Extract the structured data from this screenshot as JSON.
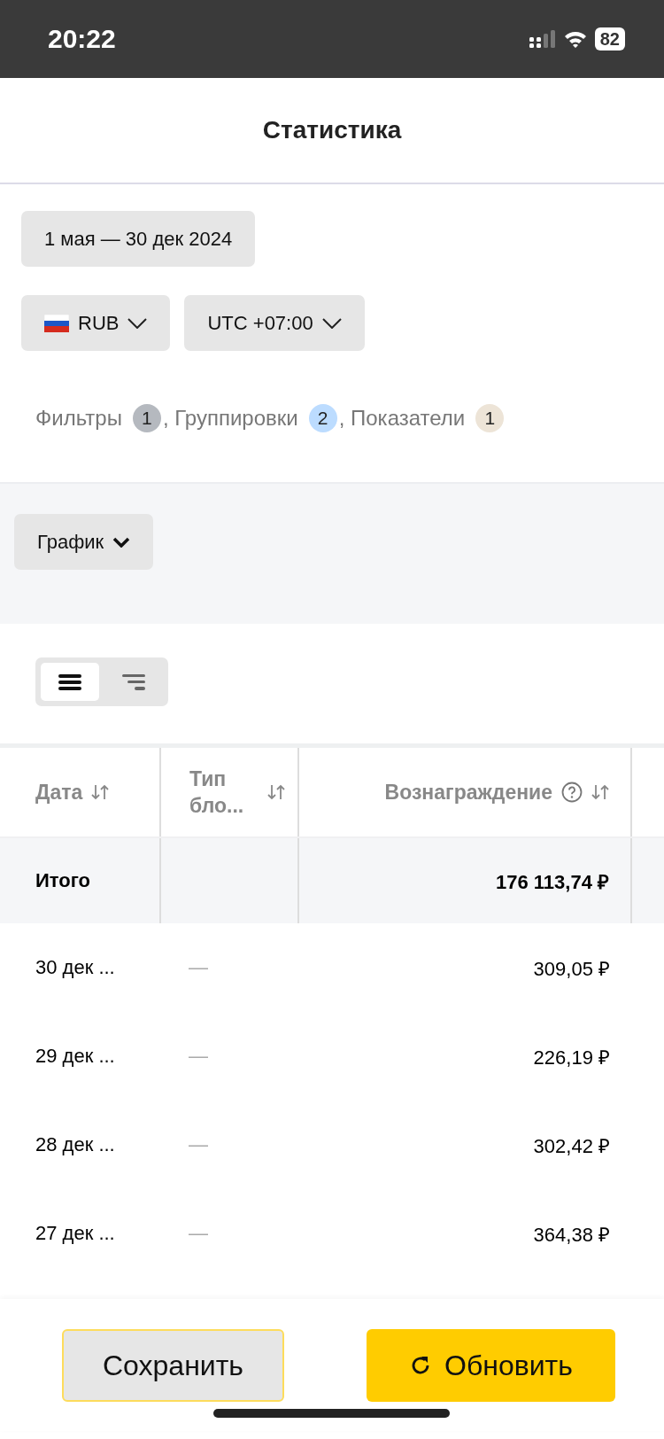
{
  "status_bar": {
    "time": "20:22",
    "battery": "82"
  },
  "header": {
    "title": "Статистика"
  },
  "period": "1 мая — 30 дек 2024",
  "currency": {
    "label": "RUB"
  },
  "timezone": {
    "label": "UTC +07:00"
  },
  "summary": [
    {
      "label": "Фильтры",
      "count": "1",
      "color": "#b5b9bf"
    },
    {
      "label": ", Группировки",
      "count": "2",
      "color": "#bcdcff"
    },
    {
      "label": ", Показатели",
      "count": "1",
      "color": "#ede4d7"
    }
  ],
  "chart_toggle": {
    "label": "График",
    "expanded": false
  },
  "view_switch": [
    {
      "kind": "flat",
      "selected": true
    },
    {
      "kind": "tree",
      "selected": false
    }
  ],
  "table": {
    "columns": [
      {
        "label": "Дата",
        "help": false
      },
      {
        "label": "Тип бло...",
        "help": false
      },
      {
        "label": "Вознаграждение",
        "help": true
      }
    ],
    "total": {
      "label": "Итого",
      "value": "176 113,74 ₽"
    },
    "rows": [
      {
        "date": "30 дек ...",
        "type": "—",
        "reward": "309,05 ₽"
      },
      {
        "date": "29 дек ...",
        "type": "—",
        "reward": "226,19 ₽"
      },
      {
        "date": "28 дек ...",
        "type": "—",
        "reward": "302,42 ₽"
      },
      {
        "date": "27 дек ...",
        "type": "—",
        "reward": "364,38 ₽"
      }
    ]
  },
  "footer": {
    "save": "Сохранить",
    "update": "Обновить"
  }
}
